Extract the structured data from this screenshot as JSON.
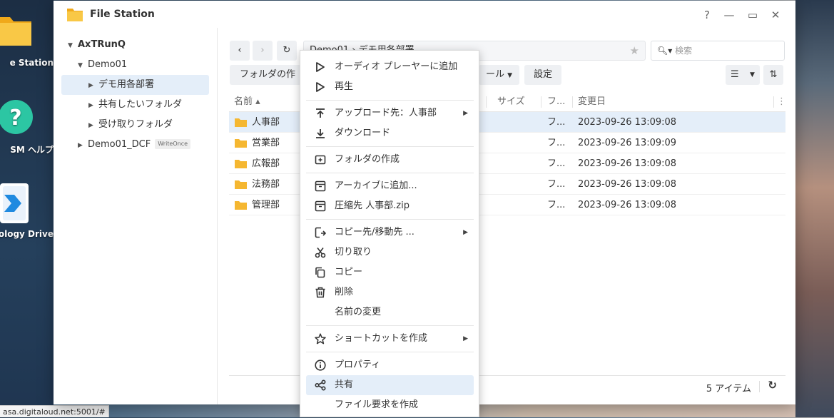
{
  "desktop": {
    "icons": [
      {
        "label": "e Station"
      },
      {
        "label": "SM ヘルプ"
      },
      {
        "label": "ology Drive"
      }
    ],
    "status_url": "asa.digitaloud.net:5001/#"
  },
  "window": {
    "title": "File Station",
    "controls": {
      "help": "?",
      "minimize": "—",
      "maximize": "▭",
      "close": "✕"
    }
  },
  "tree": {
    "root": "AxTRunQ",
    "items": [
      {
        "label": "Demo01"
      },
      {
        "label": "デモ用各部署"
      },
      {
        "label": "共有したいフォルダ"
      },
      {
        "label": "受け取りフォルダ"
      },
      {
        "label": "Demo01_DCF",
        "badge": "WriteOnce"
      }
    ]
  },
  "toolbar": {
    "path": "Demo01 › デモ用各部署",
    "search_placeholder": "検索",
    "create_folder": "フォルダの作成",
    "tools": "ール",
    "settings": "設定"
  },
  "grid": {
    "headers": {
      "name": "名前 ▴",
      "size": "サイズ",
      "type": "フ...",
      "modified": "変更日"
    },
    "rows": [
      {
        "name": "人事部",
        "type": "フ...",
        "modified": "2023-09-26 13:09:08"
      },
      {
        "name": "営業部",
        "type": "フ...",
        "modified": "2023-09-26 13:09:09"
      },
      {
        "name": "広報部",
        "type": "フ...",
        "modified": "2023-09-26 13:09:08"
      },
      {
        "name": "法務部",
        "type": "フ...",
        "modified": "2023-09-26 13:09:08"
      },
      {
        "name": "管理部",
        "type": "フ...",
        "modified": "2023-09-26 13:09:08"
      }
    ],
    "count": "5 アイテム"
  },
  "context_menu": {
    "items": [
      {
        "label": "オーディオ プレーヤーに追加"
      },
      {
        "label": "再生"
      },
      {
        "label": "アップロード先：人事部"
      },
      {
        "label": "ダウンロード"
      },
      {
        "label": "フォルダの作成"
      },
      {
        "label": "アーカイブに追加..."
      },
      {
        "label": "圧縮先 人事部.zip"
      },
      {
        "label": "コピー先/移動先 ..."
      },
      {
        "label": "切り取り"
      },
      {
        "label": "コピー"
      },
      {
        "label": "削除"
      },
      {
        "label": "名前の変更"
      },
      {
        "label": "ショートカットを作成"
      },
      {
        "label": "プロパティ"
      },
      {
        "label": "共有"
      },
      {
        "label": "ファイル要求を作成"
      }
    ]
  },
  "colors": {
    "accent": "#2f72c8",
    "selection": "#e4eef9",
    "folder": "#f5b731"
  }
}
